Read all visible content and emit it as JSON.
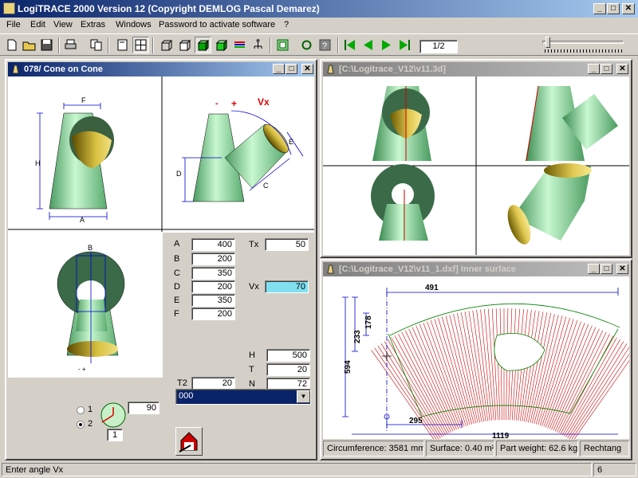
{
  "app": {
    "title": "LogiTRACE 2000  Version 12  (Copyright DEMLOG Pascal Demarez)"
  },
  "menu": [
    "File",
    "Edit",
    "View",
    "Extras",
    "Windows",
    "Password to activate software",
    "?"
  ],
  "toolbar": {
    "page": "1/2"
  },
  "win_left": {
    "title": "078/ Cone on Cone",
    "fields": [
      {
        "label": "A",
        "value": "400"
      },
      {
        "label": "B",
        "value": "200"
      },
      {
        "label": "C",
        "value": "350"
      },
      {
        "label": "D",
        "value": "200"
      },
      {
        "label": "E",
        "value": "350"
      },
      {
        "label": "F",
        "value": "200"
      }
    ],
    "tx": {
      "label": "Tx",
      "value": "50"
    },
    "vx": {
      "label": "Vx",
      "value": "70"
    },
    "h": {
      "label": "H",
      "value": "500"
    },
    "t": {
      "label": "T",
      "value": "20"
    },
    "n": {
      "label": "N",
      "value": "72"
    },
    "t2": {
      "label": "T2",
      "value": "20"
    },
    "combo": "000",
    "radio1": "1",
    "radio2": "2",
    "angle": "90",
    "angle_small": "1",
    "drawing_labels": {
      "F": "F",
      "H": "H",
      "A": "A",
      "D": "D",
      "E": "E",
      "C": "C",
      "Vx": "Vx",
      "B": "B",
      "minus": "-",
      "plus": "+",
      "pm": "- +"
    }
  },
  "win_3d": {
    "title": "[C:\\Logitrace_V12\\v11.3d]"
  },
  "win_dxf": {
    "title": "[C:\\Logitrace_V12\\v11_1.dxf]  Inner surface",
    "dims": {
      "d491": "491",
      "d178": "178",
      "d233": "233",
      "d594": "594",
      "d295": "295",
      "d1119": "1119"
    },
    "status": [
      "Circumference: 3581 mm",
      "Surface: 0.40 m²",
      "Part weight: 62.6 kg",
      "Rechtang"
    ]
  },
  "status": {
    "message": "Enter angle Vx",
    "count": "6"
  },
  "colors": {
    "title_active": "#0a246a",
    "cone_green": "#9ee8b0",
    "pattern_red": "#d00000",
    "dimension_blue": "#0000cc",
    "highlight_field": "#80e0f0"
  }
}
